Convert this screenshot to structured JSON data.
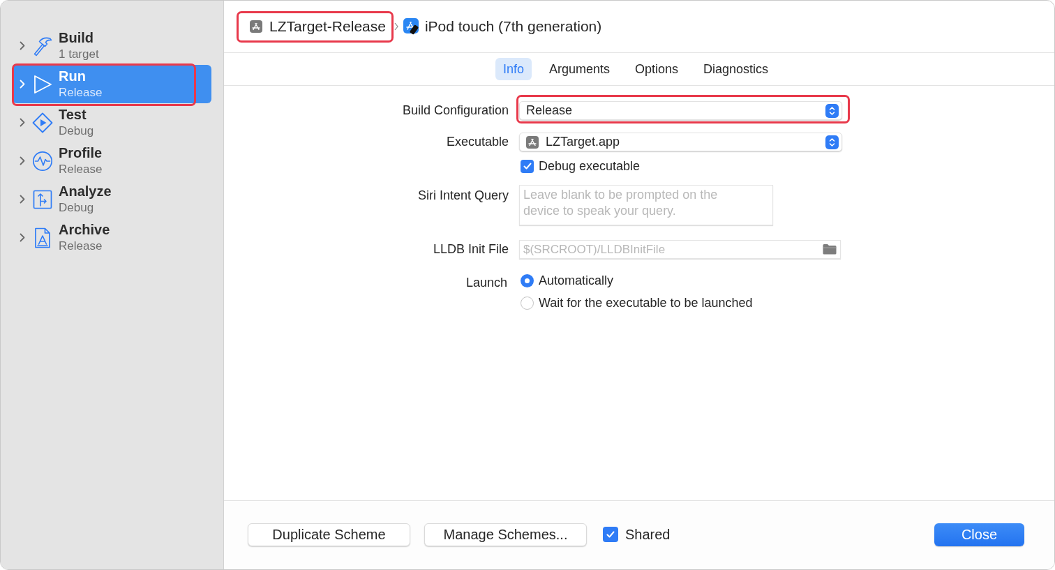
{
  "sidebar": {
    "items": [
      {
        "title": "Build",
        "subtitle": "1 target",
        "selected": false,
        "expanded": false,
        "annotated": false
      },
      {
        "title": "Run",
        "subtitle": "Release",
        "selected": true,
        "expanded": false,
        "annotated": true
      },
      {
        "title": "Test",
        "subtitle": "Debug",
        "selected": false,
        "expanded": false,
        "annotated": false
      },
      {
        "title": "Profile",
        "subtitle": "Release",
        "selected": false,
        "expanded": false,
        "annotated": false
      },
      {
        "title": "Analyze",
        "subtitle": "Debug",
        "selected": false,
        "expanded": false,
        "annotated": false
      },
      {
        "title": "Archive",
        "subtitle": "Release",
        "selected": false,
        "expanded": false,
        "annotated": false
      }
    ]
  },
  "header": {
    "scheme": {
      "label": "LZTarget-Release",
      "annotated": true
    },
    "destination": {
      "label": "iPod touch (7th generation)"
    }
  },
  "tabs": [
    {
      "label": "Info",
      "selected": true
    },
    {
      "label": "Arguments",
      "selected": false
    },
    {
      "label": "Options",
      "selected": false
    },
    {
      "label": "Diagnostics",
      "selected": false
    }
  ],
  "form": {
    "build_configuration": {
      "label": "Build Configuration",
      "value": "Release",
      "annotated": true
    },
    "executable": {
      "label": "Executable",
      "value": "LZTarget.app"
    },
    "debug_executable": {
      "label": "Debug executable",
      "checked": true
    },
    "siri_intent_query": {
      "label": "Siri Intent Query",
      "placeholder": "Leave blank to be prompted on the device to speak your query."
    },
    "lldb_init_file": {
      "label": "LLDB Init File",
      "placeholder": "$(SRCROOT)/LLDBInitFile"
    },
    "launch": {
      "label": "Launch",
      "options": [
        {
          "label": "Automatically",
          "selected": true
        },
        {
          "label": "Wait for the executable to be launched",
          "selected": false
        }
      ]
    }
  },
  "footer": {
    "duplicate_button": "Duplicate Scheme",
    "manage_button": "Manage Schemes...",
    "shared": {
      "label": "Shared",
      "checked": true
    },
    "close_button": "Close"
  }
}
